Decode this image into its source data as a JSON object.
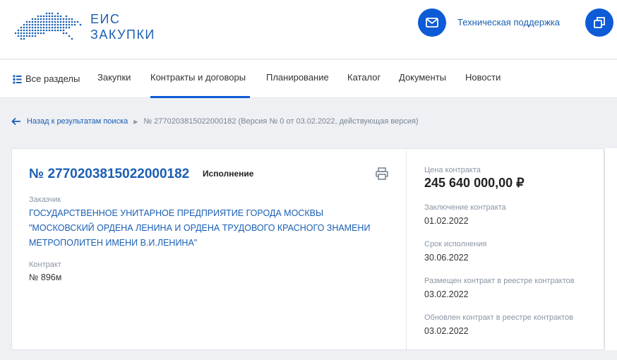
{
  "header": {
    "logo_line1": "ЕИС",
    "logo_line2": "ЗАКУПКИ",
    "support_label": "Техническая поддержка",
    "icons": {
      "support": "mail-icon",
      "login": "login-icon",
      "logo": "russia-map-logo"
    },
    "accent_color": "#0d5bd7"
  },
  "nav": {
    "items": [
      {
        "label": "Все разделы",
        "icon": "sections-icon"
      },
      {
        "label": "Закупки"
      },
      {
        "label": "Контракты и договоры",
        "active": true
      },
      {
        "label": "Планирование"
      },
      {
        "label": "Каталог"
      },
      {
        "label": "Документы"
      },
      {
        "label": "Новости"
      }
    ]
  },
  "breadcrumb": {
    "back_label": "Назад к результатам поиска",
    "current": "№ 2770203815022000182 (Версия № 0 от 03.02.2022, действующая версия)"
  },
  "contract": {
    "number": "№ 2770203815022000182",
    "status": "Исполнение",
    "customer_label": "Заказчик",
    "customer_name": "ГОСУДАРСТВЕННОЕ УНИТАРНОЕ ПРЕДПРИЯТИЕ ГОРОДА МОСКВЫ \"МОСКОВСКИЙ ОРДЕНА ЛЕНИНА И ОРДЕНА ТРУДОВОГО КРАСНОГО ЗНАМЕНИ МЕТРОПОЛИТЕН ИМЕНИ В.И.ЛЕНИНА\"",
    "contract_label": "Контракт",
    "contract_value": "№ 896м"
  },
  "details": {
    "price_label": "Цена контракта",
    "price_value": "245 640 000,00 ₽",
    "conclusion_label": "Заключение контракта",
    "conclusion_date": "01.02.2022",
    "term_label": "Срок исполнения",
    "term_date": "30.06.2022",
    "placed_label": "Размещен контракт в реестре контрактов",
    "placed_date": "03.02.2022",
    "updated_label": "Обновлен контракт в реестре контрактов",
    "updated_date": "03.02.2022"
  }
}
